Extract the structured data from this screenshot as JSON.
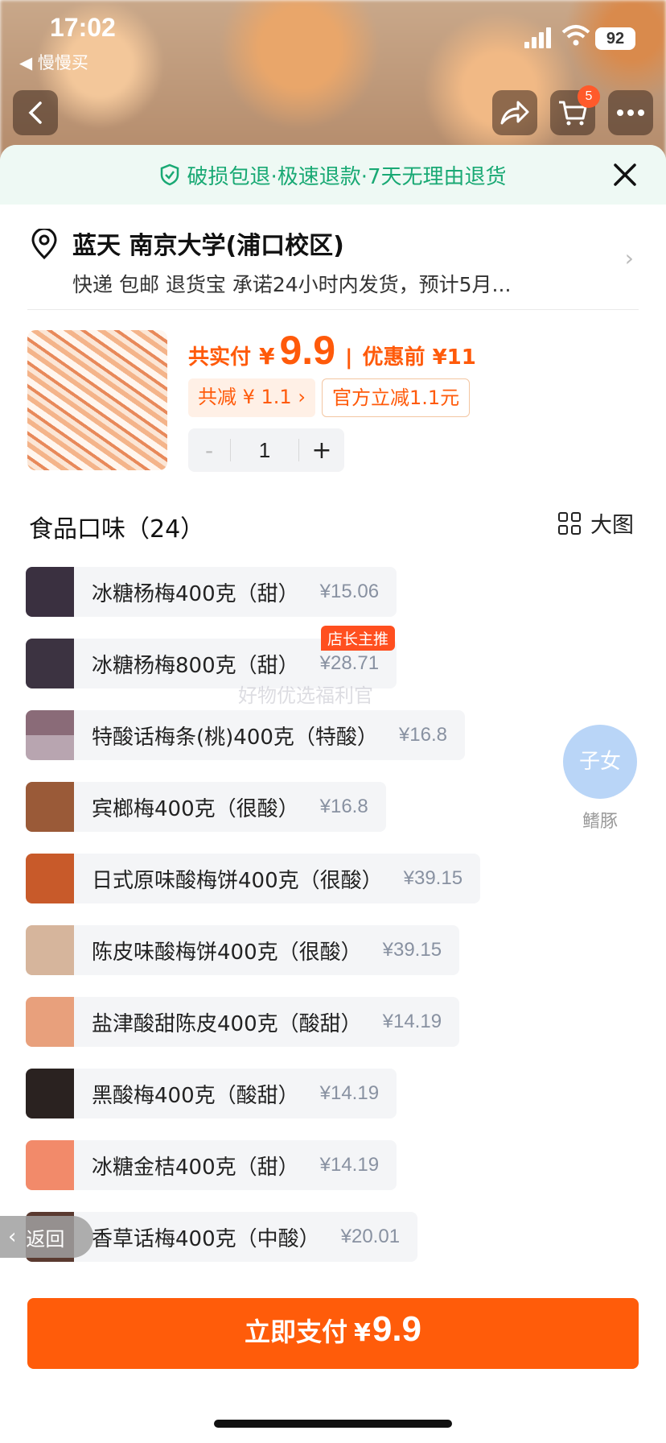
{
  "status_bar": {
    "time": "17:02",
    "back_app": "◀ 慢慢买",
    "battery": "92"
  },
  "top_nav": {
    "cart_count": "5"
  },
  "banner": {
    "text": "破损包退·极速退款·7天无理由退货"
  },
  "address": {
    "name": "蓝天 南京大学(浦口校区)",
    "delivery": "快递 包邮 退货宝 承诺24小时内发货，预计5月..."
  },
  "product": {
    "paid_label": "共实付",
    "currency": "¥",
    "paid_value": "9.9",
    "before_label": "优惠前 ¥11",
    "reduce_tag": "共减 ¥ 1.1 ›",
    "official_tag": "官方立减1.1元",
    "quantity": "1",
    "minus": "-",
    "plus": "+"
  },
  "section": {
    "title": "食品口味（24）",
    "view_toggle": "大图"
  },
  "options": [
    {
      "name": "冰糖杨梅400克（甜）",
      "price": "¥15.06",
      "color": "#3a3040",
      "badge": ""
    },
    {
      "name": "冰糖杨梅800克（甜）",
      "price": "¥28.71",
      "color": "#3c3341",
      "badge": "店长主推"
    },
    {
      "name": "特酸话梅条(桃)400克（特酸）",
      "price": "¥16.8",
      "color": "#8a6b78",
      "badge": ""
    },
    {
      "name": "宾榔梅400克（很酸）",
      "price": "¥16.8",
      "color": "#9a5a38",
      "badge": ""
    },
    {
      "name": "日式原味酸梅饼400克（很酸）",
      "price": "¥39.15",
      "color": "#c85a2a",
      "badge": ""
    },
    {
      "name": "陈皮味酸梅饼400克（很酸）",
      "price": "¥39.15",
      "color": "#d6b59c",
      "badge": ""
    },
    {
      "name": "盐津酸甜陈皮400克（酸甜）",
      "price": "¥14.19",
      "color": "#e8a07c",
      "badge": ""
    },
    {
      "name": "黑酸梅400克（酸甜）",
      "price": "¥14.19",
      "color": "#2a2220",
      "badge": ""
    },
    {
      "name": "冰糖金桔400克（甜）",
      "price": "¥14.19",
      "color": "#f28a6a",
      "badge": ""
    },
    {
      "name": "香草话梅400克（中酸）",
      "price": "¥20.01",
      "color": "#5a3a30",
      "badge": ""
    }
  ],
  "overlays": {
    "watermark": "好物优选福利官",
    "avatar_text": "子女",
    "avatar_label": "鳍豚",
    "back_label": "返回"
  },
  "pay": {
    "label": "立即支付",
    "currency": "¥",
    "value": "9.9"
  }
}
